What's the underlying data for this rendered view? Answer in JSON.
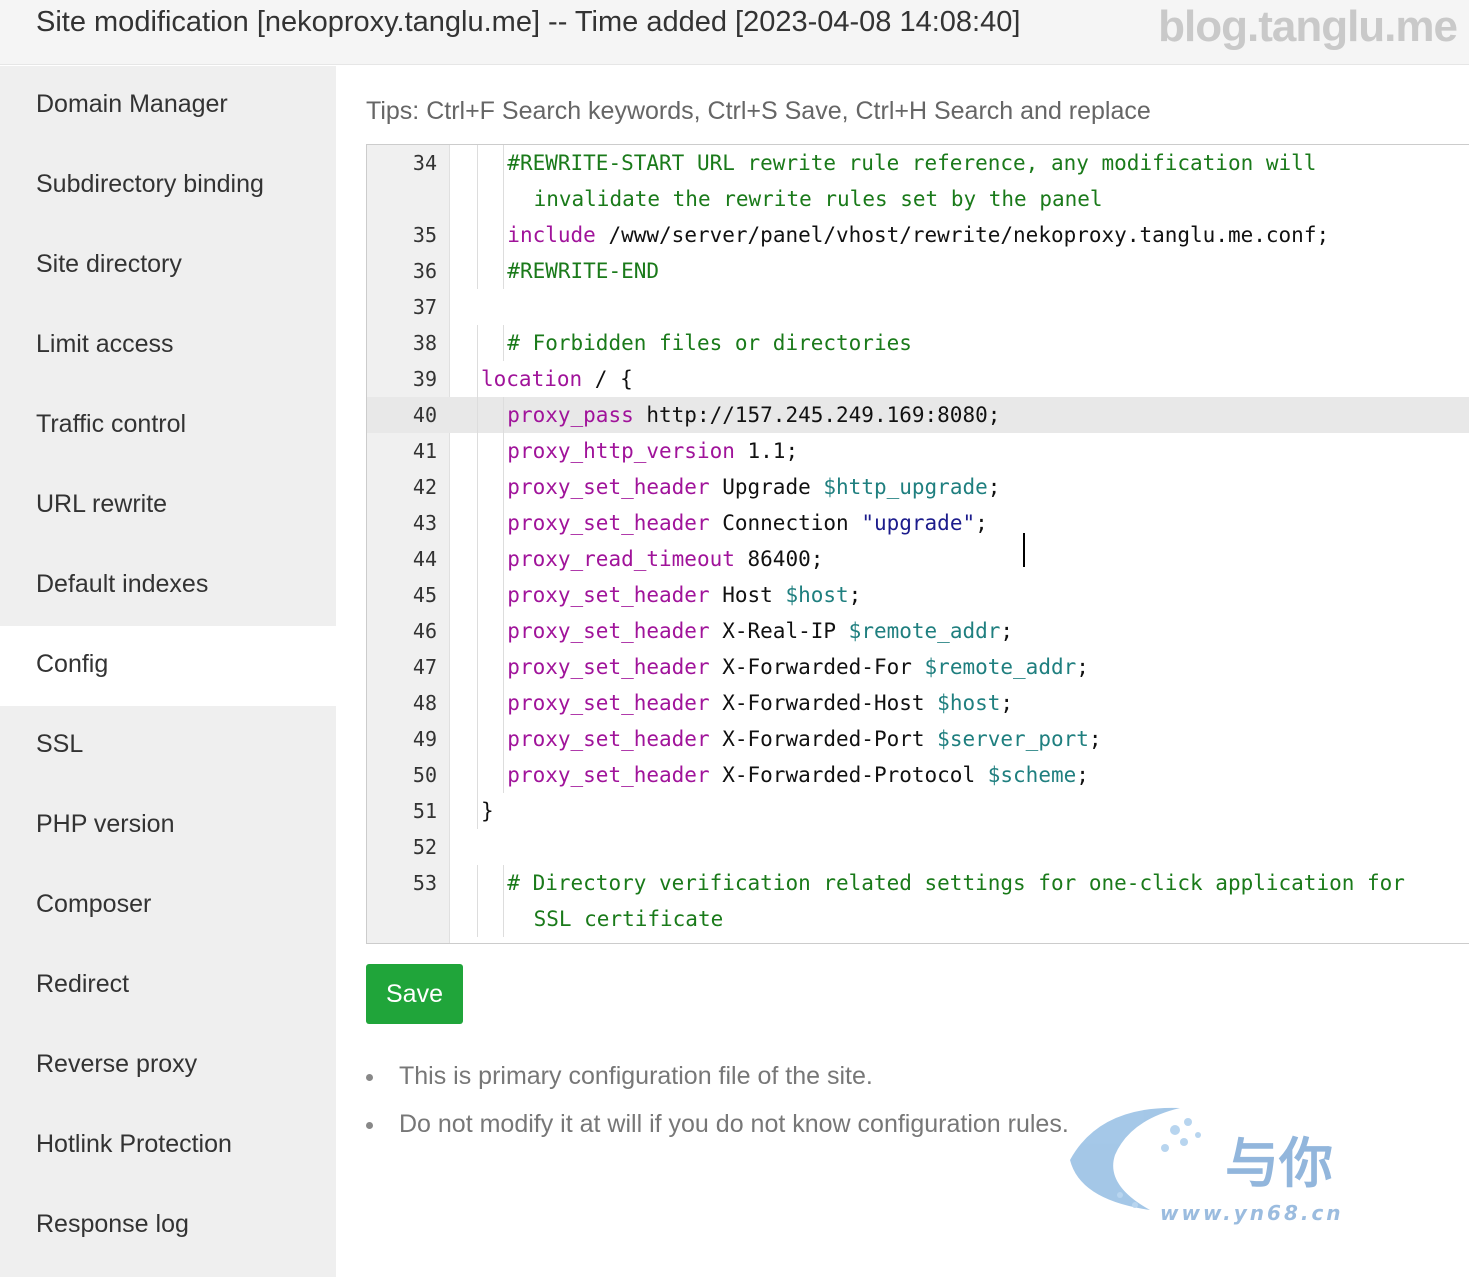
{
  "title": {
    "text": "Site modification [nekoproxy.tanglu.me] -- Time added [2023-04-08 14:08:40]",
    "watermark": "blog.tanglu.me"
  },
  "sidebar": {
    "items": [
      {
        "label": "Domain Manager"
      },
      {
        "label": "Subdirectory binding"
      },
      {
        "label": "Site directory"
      },
      {
        "label": "Limit access"
      },
      {
        "label": "Traffic control"
      },
      {
        "label": "URL rewrite"
      },
      {
        "label": "Default indexes"
      },
      {
        "label": "Config",
        "active": true
      },
      {
        "label": "SSL"
      },
      {
        "label": "PHP version"
      },
      {
        "label": "Composer"
      },
      {
        "label": "Redirect"
      },
      {
        "label": "Reverse proxy"
      },
      {
        "label": "Hotlink Protection"
      },
      {
        "label": "Response log"
      }
    ]
  },
  "tips": "Tips:  Ctrl+F Search keywords,  Ctrl+S Save,  Ctrl+H Search and replace",
  "editor": {
    "active_line": 40,
    "lines": [
      {
        "n": "34",
        "indent": 2,
        "tokens": [
          {
            "t": "#REWRITE-START URL rewrite rule reference, any modification will",
            "c": "cm"
          }
        ]
      },
      {
        "n": "",
        "indent": 3,
        "tokens": [
          {
            "t": "invalidate the rewrite rules set by the panel",
            "c": "cm"
          }
        ]
      },
      {
        "n": "35",
        "indent": 2,
        "tokens": [
          {
            "t": "include",
            "c": "kw"
          },
          {
            "t": " /www/server/panel/vhost/rewrite/nekoproxy.tanglu.me.conf;",
            "c": ""
          }
        ]
      },
      {
        "n": "36",
        "indent": 2,
        "tokens": [
          {
            "t": "#REWRITE-END",
            "c": "cm"
          }
        ]
      },
      {
        "n": "37",
        "indent": 0,
        "tokens": []
      },
      {
        "n": "38",
        "indent": 2,
        "tokens": [
          {
            "t": "# Forbidden files or directories",
            "c": "cm"
          }
        ]
      },
      {
        "n": "39",
        "indent": 1,
        "tokens": [
          {
            "t": "location",
            "c": "kw"
          },
          {
            "t": " / {",
            "c": ""
          }
        ]
      },
      {
        "n": "40",
        "indent": 2,
        "tokens": [
          {
            "t": "proxy_pass",
            "c": "kw"
          },
          {
            "t": " http://157.245.249.169:8080;",
            "c": ""
          }
        ]
      },
      {
        "n": "41",
        "indent": 2,
        "tokens": [
          {
            "t": "proxy_http_version",
            "c": "kw"
          },
          {
            "t": " 1.1;",
            "c": ""
          }
        ]
      },
      {
        "n": "42",
        "indent": 2,
        "tokens": [
          {
            "t": "proxy_set_header",
            "c": "kw"
          },
          {
            "t": " Upgrade ",
            "c": ""
          },
          {
            "t": "$http_upgrade",
            "c": "var"
          },
          {
            "t": ";",
            "c": ""
          }
        ]
      },
      {
        "n": "43",
        "indent": 2,
        "tokens": [
          {
            "t": "proxy_set_header",
            "c": "kw"
          },
          {
            "t": " Connection ",
            "c": ""
          },
          {
            "t": "\"upgrade\"",
            "c": "str"
          },
          {
            "t": ";",
            "c": ""
          }
        ]
      },
      {
        "n": "44",
        "indent": 2,
        "tokens": [
          {
            "t": "proxy_read_timeout",
            "c": "kw"
          },
          {
            "t": " 86400;",
            "c": ""
          }
        ]
      },
      {
        "n": "45",
        "indent": 2,
        "tokens": [
          {
            "t": "proxy_set_header",
            "c": "kw"
          },
          {
            "t": " Host ",
            "c": ""
          },
          {
            "t": "$host",
            "c": "var"
          },
          {
            "t": ";",
            "c": ""
          }
        ]
      },
      {
        "n": "46",
        "indent": 2,
        "tokens": [
          {
            "t": "proxy_set_header",
            "c": "kw"
          },
          {
            "t": " X-Real-IP ",
            "c": ""
          },
          {
            "t": "$remote_addr",
            "c": "var"
          },
          {
            "t": ";",
            "c": ""
          }
        ]
      },
      {
        "n": "47",
        "indent": 2,
        "tokens": [
          {
            "t": "proxy_set_header",
            "c": "kw"
          },
          {
            "t": " X-Forwarded-For ",
            "c": ""
          },
          {
            "t": "$remote_addr",
            "c": "var"
          },
          {
            "t": ";",
            "c": ""
          }
        ]
      },
      {
        "n": "48",
        "indent": 2,
        "tokens": [
          {
            "t": "proxy_set_header",
            "c": "kw"
          },
          {
            "t": " X-Forwarded-Host ",
            "c": ""
          },
          {
            "t": "$host",
            "c": "var"
          },
          {
            "t": ";",
            "c": ""
          }
        ]
      },
      {
        "n": "49",
        "indent": 2,
        "tokens": [
          {
            "t": "proxy_set_header",
            "c": "kw"
          },
          {
            "t": " X-Forwarded-Port ",
            "c": ""
          },
          {
            "t": "$server_port",
            "c": "var"
          },
          {
            "t": ";",
            "c": ""
          }
        ]
      },
      {
        "n": "50",
        "indent": 2,
        "tokens": [
          {
            "t": "proxy_set_header",
            "c": "kw"
          },
          {
            "t": " X-Forwarded-Protocol ",
            "c": ""
          },
          {
            "t": "$scheme",
            "c": "var"
          },
          {
            "t": ";",
            "c": ""
          }
        ]
      },
      {
        "n": "51",
        "indent": 1,
        "tokens": [
          {
            "t": "}",
            "c": ""
          }
        ]
      },
      {
        "n": "52",
        "indent": 0,
        "tokens": []
      },
      {
        "n": "53",
        "indent": 2,
        "tokens": [
          {
            "t": "# Directory verification related settings for one-click application for",
            "c": "cm"
          }
        ]
      },
      {
        "n": "",
        "indent": 3,
        "tokens": [
          {
            "t": "SSL certificate",
            "c": "cm"
          }
        ]
      }
    ]
  },
  "save_label": "Save",
  "notes": [
    "This is primary configuration file of the site.",
    "Do not modify it at will if you do not know configuration rules."
  ],
  "watermark_logo": {
    "cn": "与你",
    "url": "www.yn68.cn"
  },
  "colors": {
    "accent": "#20a53a",
    "comment": "#1a7a1a",
    "keyword": "#a0139a",
    "variable": "#1f7f7f",
    "string": "#1c1c8c"
  }
}
